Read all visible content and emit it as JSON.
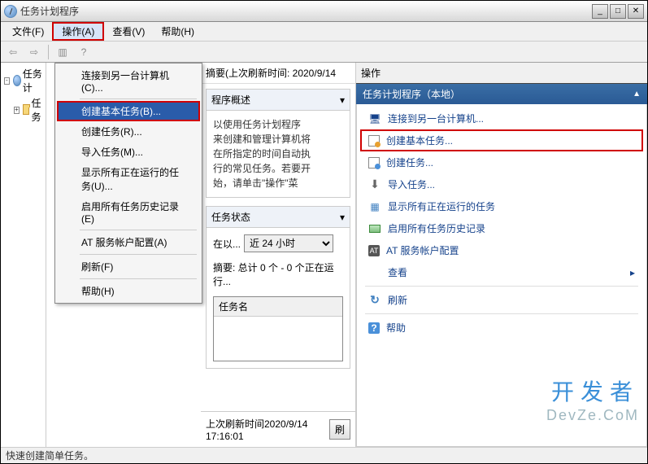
{
  "window": {
    "title": "任务计划程序"
  },
  "menubar": {
    "file": "文件(F)",
    "action": "操作(A)",
    "view": "查看(V)",
    "help": "帮助(H)"
  },
  "dropdown": {
    "connect": "连接到另一台计算机(C)...",
    "create_basic": "创建基本任务(B)...",
    "create_task": "创建任务(R)...",
    "import": "导入任务(M)...",
    "show_running": "显示所有正在运行的任务(U)...",
    "enable_history": "启用所有任务历史记录(E)",
    "at_account": "AT 服务帐户配置(A)",
    "refresh": "刷新(F)",
    "help": "帮助(H)"
  },
  "tree": {
    "root": "任务计",
    "child": "任务"
  },
  "center": {
    "summary_label": "摘要(上次刷新时间: 2020/9/14",
    "overview_header": "程序概述",
    "overview_text": "以使用任务计划程序\n来创建和管理计算机将\n在所指定的时间自动执\n行的常见任务。若要开\n始，请单击\"操作\"菜",
    "status_header": "任务状态",
    "status_label": "在以...",
    "time_range": "近 24 小时",
    "status_summary": "摘要: 总计 0 个 - 0 个正在运行...",
    "task_name_col": "任务名",
    "footer_time": "上次刷新时间2020/9/14 17:16:01",
    "refresh_btn": "刷"
  },
  "actions": {
    "panel_header": "操作",
    "subheader": "任务计划程序（本地）",
    "items": {
      "connect": "连接到另一台计算机...",
      "create_basic": "创建基本任务...",
      "create_task": "创建任务...",
      "import": "导入任务...",
      "show_running": "显示所有正在运行的任务",
      "enable_history": "启用所有任务历史记录",
      "at_account": "AT 服务帐户配置",
      "view": "查看",
      "refresh": "刷新",
      "help": "帮助"
    }
  },
  "statusbar": {
    "text": "快速创建简单任务。"
  },
  "watermark": {
    "l1": "开发者",
    "l2": "DevZe.CoM"
  }
}
